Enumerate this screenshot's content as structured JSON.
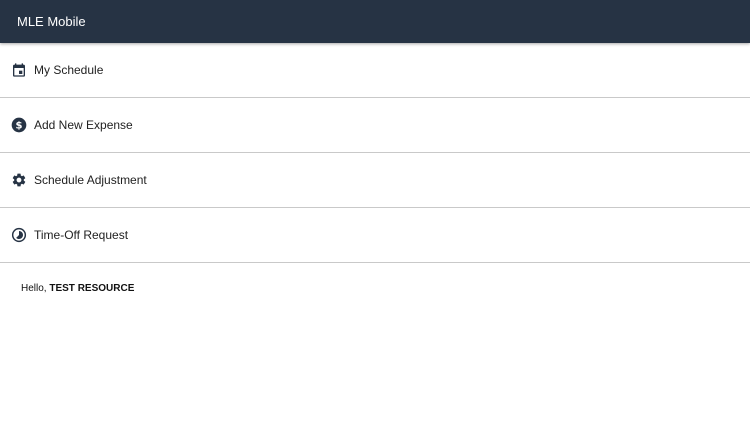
{
  "appbar": {
    "title": "MLE Mobile",
    "background": "#263344"
  },
  "menu": {
    "items": [
      {
        "label": "My Schedule",
        "icon": "calendar-icon"
      },
      {
        "label": "Add New Expense",
        "icon": "dollar-circle-icon"
      },
      {
        "label": "Schedule Adjustment",
        "icon": "gear-icon"
      },
      {
        "label": "Time-Off Request",
        "icon": "clock-icon"
      }
    ]
  },
  "greeting": {
    "prefix": "Hello, ",
    "name": "TEST RESOURCE"
  }
}
